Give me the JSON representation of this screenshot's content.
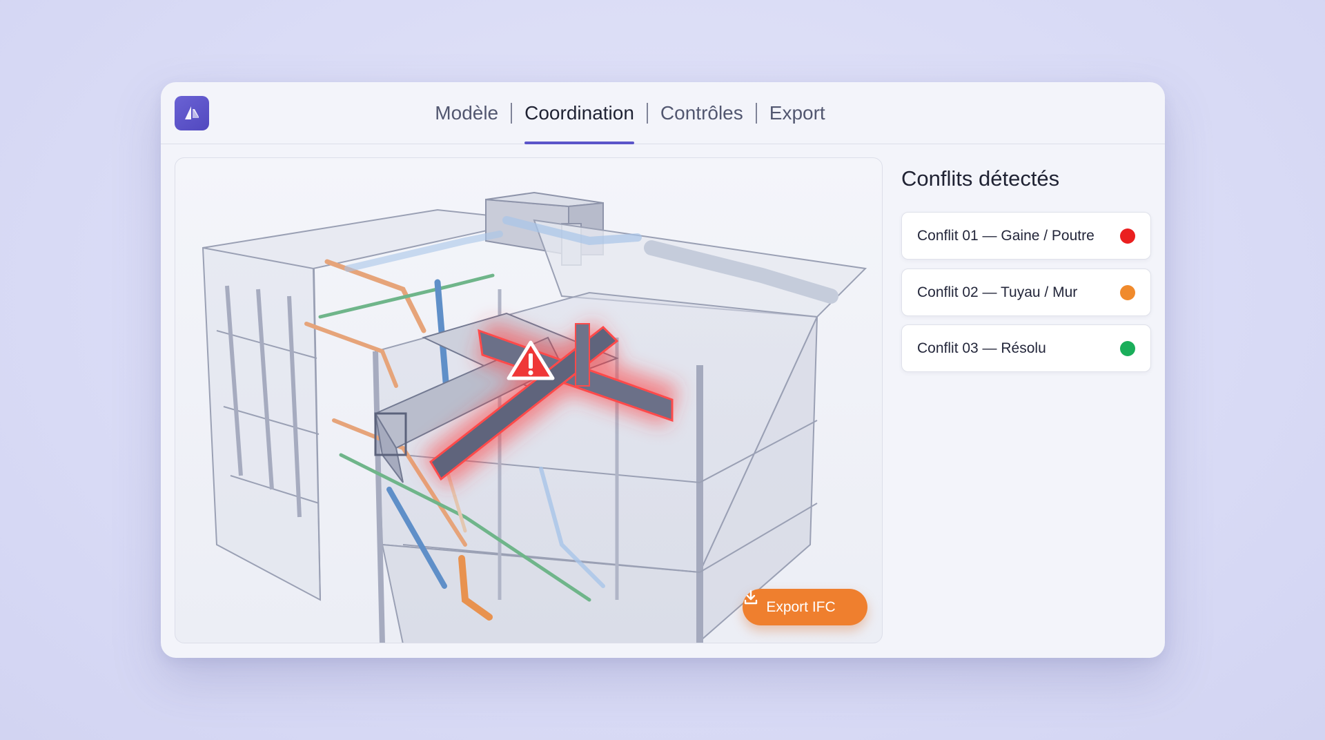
{
  "app": {
    "logo_icon": "building-logo-icon",
    "accent_color": "#5b55c9"
  },
  "nav": {
    "tabs": [
      {
        "label": "Modèle",
        "active": false
      },
      {
        "label": "Coordination",
        "active": true
      },
      {
        "label": "Contrôles",
        "active": false
      },
      {
        "label": "Export",
        "active": false
      }
    ]
  },
  "viewport": {
    "warning_icon": "warning-triangle-icon",
    "export_button": {
      "label": "Export IFC",
      "icon": "download-icon",
      "color": "#ef7f2e"
    }
  },
  "panel": {
    "title": "Conflits détectés",
    "conflicts": [
      {
        "label": "Conflit 01 — Gaine / Poutre",
        "status_color": "#ea1f1f"
      },
      {
        "label": "Conflit 02 — Tuyau / Mur",
        "status_color": "#f08a2c"
      },
      {
        "label": "Conflit 03 — Résolu",
        "status_color": "#1aae5a"
      }
    ]
  }
}
